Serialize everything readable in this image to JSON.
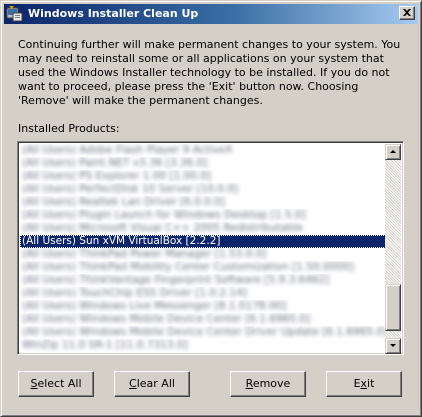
{
  "window": {
    "title": "Windows Installer Clean Up"
  },
  "message": "Continuing further will make permanent changes to your system. You may need to reinstall some or all applications on your system that used the Windows Installer technology to be installed. If you do not want to proceed, please press the 'Exit' button now. Choosing 'Remove' will make the permanent changes.",
  "products_label": "Installed Products:",
  "list": {
    "items_before": [
      "(All Users) Adobe Flash Player 9 ActiveX",
      "(All Users) Paint.NET v3.36 [3.36.0]",
      "(All Users) PS Explorer 1.00 [1.00.0]",
      "(All Users) PerfectDisk 10 Server [10.0.0]",
      "(All Users) Realtek Lan Driver [6.0.0.0]",
      "(All Users) Plugin Launch for Windows Desktop [1.5.0]",
      "(All Users) Microsoft Visual C++ 2005 Redistributable"
    ],
    "selected": "(All Users) Sun xVM VirtualBox [2.2.2]",
    "items_after": [
      "(All Users) ThinkPad Power Manager [1.53.0.0]",
      "(All Users) ThinkPad Mobility Center Customization [1.50.0000]",
      "(All Users) ThinkVantage Fingerprint Software [5.9.3.6462]",
      "(All Users) TouchChip ESS Driver [1.0.2.14]",
      "(All Users) Windows Live Messenger [8.1.0178.00]",
      "(All Users) Windows Mobile Device Center [6.1.6965.0]",
      "(All Users) Windows Mobile Device Center Driver Update [6.1.6965.0]",
      "WinZip 11.0 SR-1 [11.0.7313.0]"
    ]
  },
  "buttons": {
    "select_all": {
      "accel": "S",
      "rest": "elect All"
    },
    "clear_all": {
      "accel": "C",
      "rest": "lear All"
    },
    "remove": {
      "accel": "R",
      "rest": "emove"
    },
    "exit": {
      "pre": "E",
      "accel": "x",
      "rest": "it"
    }
  }
}
